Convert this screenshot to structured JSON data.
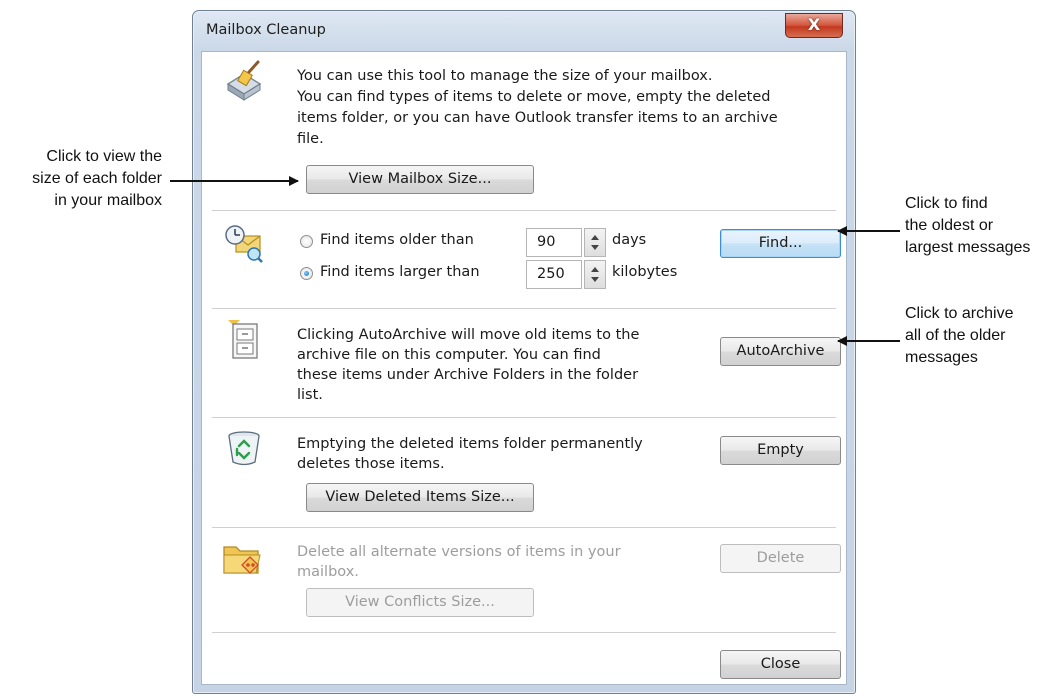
{
  "callouts": {
    "left": [
      "Click to view the",
      "size of each folder",
      "in your mailbox"
    ],
    "find": [
      "Click to find",
      "the oldest or",
      "largest messages"
    ],
    "archive": [
      "Click to archive",
      "all of the older",
      "messages"
    ]
  },
  "window": {
    "title": "Mailbox Cleanup",
    "close_glyph": "X"
  },
  "intro": {
    "line1": "You can use this tool to manage the size of your mailbox.",
    "line2": "You can find types of items to delete or move, empty the deleted",
    "line3": "items folder, or you can have Outlook transfer items to an archive",
    "line4": "file.",
    "view_size_button": "View Mailbox Size..."
  },
  "find": {
    "older_label": "Find items older than",
    "older_value": "90",
    "older_unit": "days",
    "larger_label": "Find items larger than",
    "larger_value": "250",
    "larger_unit": "kilobytes",
    "selected": "larger",
    "button": "Find..."
  },
  "autoarchive": {
    "line1": "Clicking AutoArchive will move old items to the",
    "line2": "archive file on this computer. You can find",
    "line3": "these items under Archive Folders in the folder",
    "line4": "list.",
    "button": "AutoArchive"
  },
  "empty": {
    "line1": "Emptying the deleted items folder permanently",
    "line2": "deletes those items.",
    "button": "Empty",
    "view_button": "View Deleted Items Size..."
  },
  "conflicts": {
    "line1": "Delete all alternate versions of items in your",
    "line2": "mailbox.",
    "button": "Delete",
    "view_button": "View Conflicts Size...",
    "disabled": true
  },
  "footer": {
    "close_button": "Close"
  },
  "icons": {
    "intro": "cleanup-broom-icon",
    "find": "find-clock-mail-icon",
    "autoarchive": "archive-cabinet-icon",
    "empty": "recycle-bin-icon",
    "conflicts": "conflict-folder-icon"
  }
}
